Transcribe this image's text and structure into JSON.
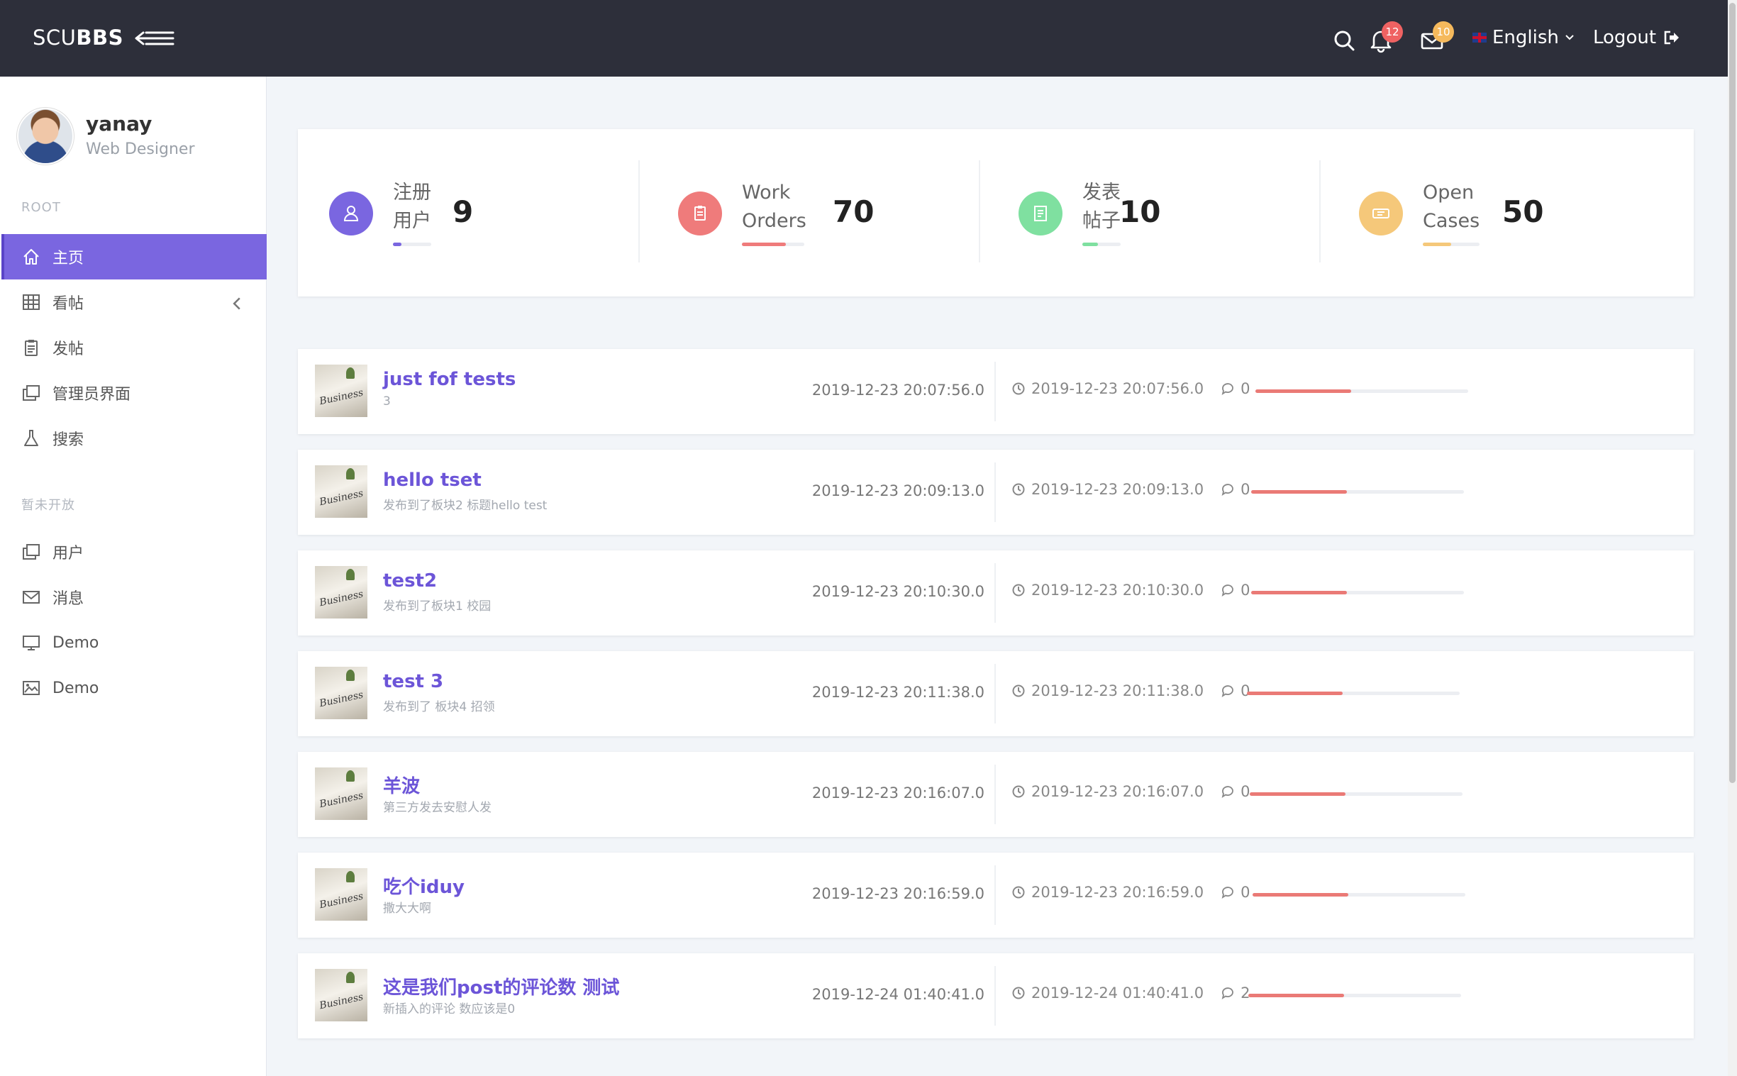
{
  "brand": {
    "prefix": "SCU",
    "bold": "BBS"
  },
  "topbar": {
    "notifications_count": "12",
    "messages_count": "10",
    "language": "English",
    "logout": "Logout",
    "notif_badge_color": "#ef6262",
    "msg_badge_color": "#f5b95c"
  },
  "profile": {
    "name": "yanay",
    "role": "Web Designer"
  },
  "sidebar": {
    "root_label": "ROOT",
    "closed_label": "暂未开放",
    "items": [
      {
        "label": "主页",
        "icon": "home-icon",
        "active": true
      },
      {
        "label": "看帖",
        "icon": "grid-icon",
        "active": false
      },
      {
        "label": "发帖",
        "icon": "clipboard-icon",
        "active": false
      },
      {
        "label": "管理员界面",
        "icon": "windows-icon",
        "active": false
      },
      {
        "label": "搜索",
        "icon": "flask-icon",
        "active": false
      }
    ],
    "closed_items": [
      {
        "label": "用户",
        "icon": "windows-icon"
      },
      {
        "label": "消息",
        "icon": "mail-icon"
      },
      {
        "label": "Demo",
        "icon": "monitor-icon"
      },
      {
        "label": "Demo",
        "icon": "image-icon"
      }
    ]
  },
  "stats": [
    {
      "line1": "注册",
      "line2": "用户",
      "value": "9",
      "color": "#7a66e0",
      "progress": 0.22,
      "icon": "user-icon"
    },
    {
      "line1": "Work",
      "line2": "Orders",
      "value": "70",
      "color": "#ef7b7b",
      "progress": 0.7,
      "icon": "clipboard-icon"
    },
    {
      "line1": "发表",
      "line2": "帖子",
      "value": "10",
      "color": "#7fe0a0",
      "progress": 0.4,
      "icon": "document-icon"
    },
    {
      "line1": "Open",
      "line2": "Cases",
      "value": "50",
      "color": "#f5c87a",
      "progress": 0.5,
      "icon": "ticket-icon"
    }
  ],
  "posts": [
    {
      "title": "just fof tests",
      "subtitle": "3",
      "date": "2019-12-23 20:07:56.0",
      "meta_date": "2019-12-23 20:07:56.0",
      "comments": "0",
      "progress": 0.45
    },
    {
      "title": "hello tset",
      "subtitle": "发布到了板块2 标题hello test",
      "date": "2019-12-23 20:09:13.0",
      "meta_date": "2019-12-23 20:09:13.0",
      "comments": "0",
      "progress": 0.45
    },
    {
      "title": "test2",
      "subtitle": "发布到了板块1 校园",
      "date": "2019-12-23 20:10:30.0",
      "meta_date": "2019-12-23 20:10:30.0",
      "comments": "0",
      "progress": 0.45
    },
    {
      "title": "test 3",
      "subtitle": "发布到了 板块4 招领",
      "date": "2019-12-23 20:11:38.0",
      "meta_date": "2019-12-23 20:11:38.0",
      "comments": "0",
      "progress": 0.45
    },
    {
      "title": "羊波",
      "subtitle": "第三方发去安慰人发",
      "date": "2019-12-23 20:16:07.0",
      "meta_date": "2019-12-23 20:16:07.0",
      "comments": "0",
      "progress": 0.45
    },
    {
      "title": "吃个iduy",
      "subtitle": "撒大大啊",
      "date": "2019-12-23 20:16:59.0",
      "meta_date": "2019-12-23 20:16:59.0",
      "comments": "0",
      "progress": 0.45
    },
    {
      "title": "这是我们post的评论数 测试",
      "subtitle": "新插入的评论 数应该是0",
      "date": "2019-12-24 01:40:41.0",
      "meta_date": "2019-12-24 01:40:41.0",
      "comments": "2",
      "progress": 0.45
    }
  ],
  "thumb_text": "Business"
}
